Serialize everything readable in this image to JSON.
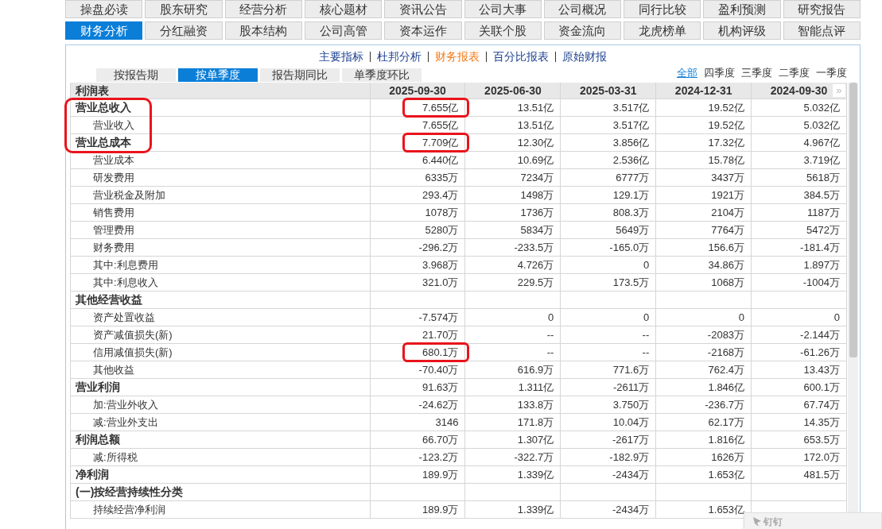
{
  "main_tabs": [
    {
      "label": "操盘必读",
      "selected": false
    },
    {
      "label": "股东研究",
      "selected": false
    },
    {
      "label": "经营分析",
      "selected": false
    },
    {
      "label": "核心题材",
      "selected": false
    },
    {
      "label": "资讯公告",
      "selected": false
    },
    {
      "label": "公司大事",
      "selected": false
    },
    {
      "label": "公司概况",
      "selected": false
    },
    {
      "label": "同行比较",
      "selected": false
    },
    {
      "label": "盈利预测",
      "selected": false
    },
    {
      "label": "研究报告",
      "selected": false
    },
    {
      "label": "财务分析",
      "selected": true
    },
    {
      "label": "分红融资",
      "selected": false
    },
    {
      "label": "股本结构",
      "selected": false
    },
    {
      "label": "公司高管",
      "selected": false
    },
    {
      "label": "资本运作",
      "selected": false
    },
    {
      "label": "关联个股",
      "selected": false
    },
    {
      "label": "资金流向",
      "selected": false
    },
    {
      "label": "龙虎榜单",
      "selected": false
    },
    {
      "label": "机构评级",
      "selected": false
    },
    {
      "label": "智能点评",
      "selected": false
    }
  ],
  "report_links": [
    {
      "label": "主要指标",
      "selected": false
    },
    {
      "label": "杜邦分析",
      "selected": false
    },
    {
      "label": "财务报表",
      "selected": true
    },
    {
      "label": "百分比报表",
      "selected": false
    },
    {
      "label": "原始财报",
      "selected": false
    }
  ],
  "period_tabs": [
    {
      "label": "按报告期",
      "selected": false
    },
    {
      "label": "按单季度",
      "selected": true
    },
    {
      "label": "报告期同比",
      "selected": false
    },
    {
      "label": "单季度环比",
      "selected": false
    }
  ],
  "quarter_filter": [
    {
      "label": "全部",
      "selected": true
    },
    {
      "label": "四季度",
      "selected": false
    },
    {
      "label": "三季度",
      "selected": false
    },
    {
      "label": "二季度",
      "selected": false
    },
    {
      "label": "一季度",
      "selected": false
    }
  ],
  "table": {
    "title": "利润表",
    "columns": [
      "2025-09-30",
      "2025-06-30",
      "2025-03-31",
      "2024-12-31",
      "2024-09-30"
    ],
    "more": "»",
    "rows": [
      {
        "label": "营业总收入",
        "kind": "section",
        "label_circled": true,
        "values": [
          "7.655亿",
          "13.51亿",
          "3.517亿",
          "19.52亿",
          "5.032亿"
        ],
        "circled": [
          true,
          false,
          false,
          false,
          false
        ]
      },
      {
        "label": "营业收入",
        "kind": "item",
        "label_circled": true,
        "values": [
          "7.655亿",
          "13.51亿",
          "3.517亿",
          "19.52亿",
          "5.032亿"
        ]
      },
      {
        "label": "营业总成本",
        "kind": "section",
        "label_circled": true,
        "values": [
          "7.709亿",
          "12.30亿",
          "3.856亿",
          "17.32亿",
          "4.967亿"
        ],
        "circled": [
          true,
          false,
          false,
          false,
          false
        ]
      },
      {
        "label": "营业成本",
        "kind": "item",
        "values": [
          "6.440亿",
          "10.69亿",
          "2.536亿",
          "15.78亿",
          "3.719亿"
        ]
      },
      {
        "label": "研发费用",
        "kind": "item",
        "values": [
          "6335万",
          "7234万",
          "6777万",
          "3437万",
          "5618万"
        ]
      },
      {
        "label": "营业税金及附加",
        "kind": "item",
        "values": [
          "293.4万",
          "1498万",
          "129.1万",
          "1921万",
          "384.5万"
        ]
      },
      {
        "label": "销售费用",
        "kind": "item",
        "values": [
          "1078万",
          "1736万",
          "808.3万",
          "2104万",
          "1187万"
        ]
      },
      {
        "label": "管理费用",
        "kind": "item",
        "values": [
          "5280万",
          "5834万",
          "5649万",
          "7764万",
          "5472万"
        ]
      },
      {
        "label": "财务费用",
        "kind": "item",
        "values": [
          "-296.2万",
          "-233.5万",
          "-165.0万",
          "156.6万",
          "-181.4万"
        ]
      },
      {
        "label": "其中:利息费用",
        "kind": "item",
        "values": [
          "3.968万",
          "4.726万",
          "0",
          "34.86万",
          "1.897万"
        ]
      },
      {
        "label": "其中:利息收入",
        "kind": "item",
        "values": [
          "321.0万",
          "229.5万",
          "173.5万",
          "1068万",
          "-1004万"
        ]
      },
      {
        "label": "其他经营收益",
        "kind": "section"
      },
      {
        "label": "资产处置收益",
        "kind": "item",
        "values": [
          "-7.574万",
          "0",
          "0",
          "0",
          "0"
        ]
      },
      {
        "label": "资产减值损失(新)",
        "kind": "item",
        "values": [
          "21.70万",
          "--",
          "--",
          "-2083万",
          "-2.144万"
        ]
      },
      {
        "label": "信用减值损失(新)",
        "kind": "item",
        "values": [
          "680.1万",
          "--",
          "--",
          "-2168万",
          "-61.26万"
        ],
        "circled": [
          true,
          false,
          false,
          false,
          false
        ]
      },
      {
        "label": "其他收益",
        "kind": "item",
        "values": [
          "-70.40万",
          "616.9万",
          "771.6万",
          "762.4万",
          "13.43万"
        ]
      },
      {
        "label": "营业利润",
        "kind": "section",
        "values": [
          "91.63万",
          "1.311亿",
          "-2611万",
          "1.846亿",
          "600.1万"
        ]
      },
      {
        "label": "加:营业外收入",
        "kind": "item",
        "values": [
          "-24.62万",
          "133.8万",
          "3.750万",
          "-236.7万",
          "67.74万"
        ]
      },
      {
        "label": "减:营业外支出",
        "kind": "item",
        "values": [
          "3146",
          "171.8万",
          "10.04万",
          "62.17万",
          "14.35万"
        ]
      },
      {
        "label": "利润总额",
        "kind": "section",
        "values": [
          "66.70万",
          "1.307亿",
          "-2617万",
          "1.816亿",
          "653.5万"
        ]
      },
      {
        "label": "减:所得税",
        "kind": "item",
        "values": [
          "-123.2万",
          "-322.7万",
          "-182.9万",
          "1626万",
          "172.0万"
        ]
      },
      {
        "label": "净利润",
        "kind": "section",
        "values": [
          "189.9万",
          "1.339亿",
          "-2434万",
          "1.653亿",
          "481.5万"
        ]
      },
      {
        "label": "(一)按经营持续性分类",
        "kind": "section"
      },
      {
        "label": "持续经营净利润",
        "kind": "item",
        "values": [
          "189.9万",
          "1.339亿",
          "-2434万",
          "1.653亿"
        ]
      }
    ]
  },
  "popup": {
    "label": "钉钉"
  }
}
